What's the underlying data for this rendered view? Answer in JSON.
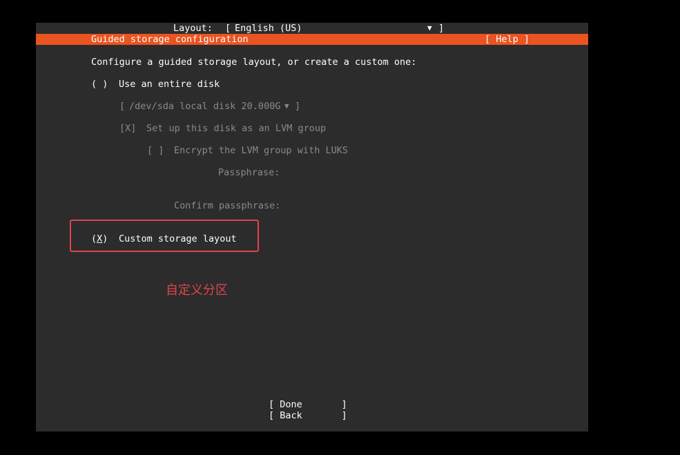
{
  "header": {
    "layout_label": "Layout:",
    "layout_open_bracket": "[",
    "layout_value": "English (US)",
    "layout_arrow": "▼",
    "layout_close_bracket": "]"
  },
  "titlebar": {
    "title": "Guided storage configuration",
    "help_button": "[ Help ]",
    "background_color": "#e95420"
  },
  "main": {
    "intro": "Configure a guided storage layout, or create a custom one:",
    "entire_disk": {
      "radio": "( )",
      "label": "Use an entire disk"
    },
    "disk_select": {
      "open_bracket": "[",
      "value": "/dev/sda local disk 20.000G",
      "arrow": "▼",
      "close_bracket": "]"
    },
    "lvm": {
      "checkbox": "[X]",
      "label": "Set up this disk as an LVM group"
    },
    "encrypt": {
      "checkbox": "[ ]",
      "label": "Encrypt the LVM group with LUKS"
    },
    "passphrase_label": "Passphrase:",
    "confirm_passphrase_label": "Confirm passphrase:",
    "custom_layout": {
      "radio_open": "(",
      "radio_mark": "X",
      "radio_close": ")",
      "label": "Custom storage layout"
    }
  },
  "annotation": {
    "text": "自定义分区",
    "color": "#e0454a"
  },
  "footer": {
    "done_button": "[ Done       ]",
    "back_button": "[ Back       ]"
  }
}
